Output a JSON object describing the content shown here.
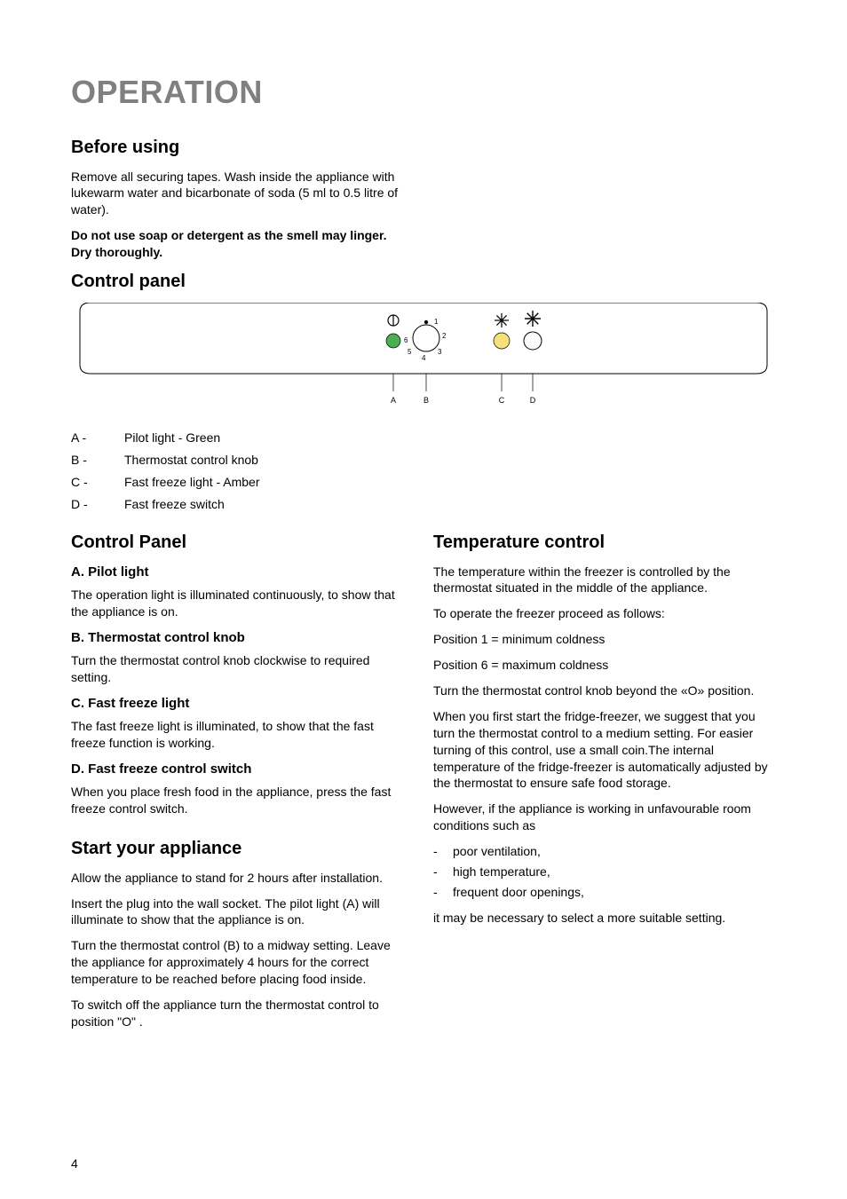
{
  "title": "OPERATION",
  "before_using": {
    "heading": "Before using",
    "p1": "Remove all securing tapes. Wash inside the appliance with lukewarm water and bicarbonate of soda (5 ml to 0.5 litre of water).",
    "p2": "Do not use soap or detergent as the smell may linger. Dry thoroughly."
  },
  "control_panel": {
    "heading": "Control panel",
    "legend": [
      {
        "key": "A -",
        "val": "Pilot light - Green"
      },
      {
        "key": "B -",
        "val": "Thermostat control knob"
      },
      {
        "key": "C -",
        "val": "Fast freeze light - Amber"
      },
      {
        "key": "D -",
        "val": "Fast freeze switch"
      }
    ]
  },
  "diagram": {
    "nums": {
      "n1": "1",
      "n2": "2",
      "n3": "3",
      "n4": "4",
      "n5": "5",
      "n6": "6"
    },
    "labels": {
      "A": "A",
      "B": "B",
      "C": "C",
      "D": "D"
    }
  },
  "left_col": {
    "cp_heading": "Control Panel",
    "a_head": "A. Pilot light",
    "a_text": "The operation light is illuminated continuously, to show that the appliance is on.",
    "b_head": "B. Thermostat control knob",
    "b_text": "Turn the thermostat control knob clockwise to required setting.",
    "c_head": "C. Fast freeze light",
    "c_text": "The fast freeze light is illuminated, to show that the fast freeze function is working.",
    "d_head": "D. Fast freeze control switch",
    "d_text": "When you place fresh food in the appliance, press the fast freeze control switch.",
    "start_head": "Start your appliance",
    "start_p1": "Allow the appliance to stand for 2 hours after installation.",
    "start_p2": "Insert the plug into the wall socket. The pilot light (A) will illuminate to show that the appliance is on.",
    "start_p3": "Turn the thermostat control (B) to a midway setting. Leave the appliance for approximately 4 hours for the correct temperature to be reached before placing food inside.",
    "start_p4": "To switch off the appliance turn the thermostat control to position \"O\" ."
  },
  "right_col": {
    "temp_head": "Temperature control",
    "temp_p1": "The temperature within the freezer is controlled by the thermostat situated in the middle of the appliance.",
    "temp_p2": "To operate the freezer proceed as follows:",
    "temp_p3": "Position 1 = minimum coldness",
    "temp_p4": "Position 6 = maximum coldness",
    "temp_p5": "Turn the thermostat control knob beyond the «O» position.",
    "temp_p6": "When you first start the fridge-freezer, we suggest that you turn the thermostat control to a medium setting. For easier turning of this control, use a small coin.The internal temperature of the fridge-freezer is automatically adjusted by the thermostat to ensure safe food storage.",
    "temp_p7": "However, if the appliance is working in unfavourable room conditions such as",
    "bullets": [
      "poor ventilation,",
      "high temperature,",
      "frequent door openings,"
    ],
    "temp_p8": "it may be necessary to select a more suitable setting."
  },
  "page_num": "4"
}
